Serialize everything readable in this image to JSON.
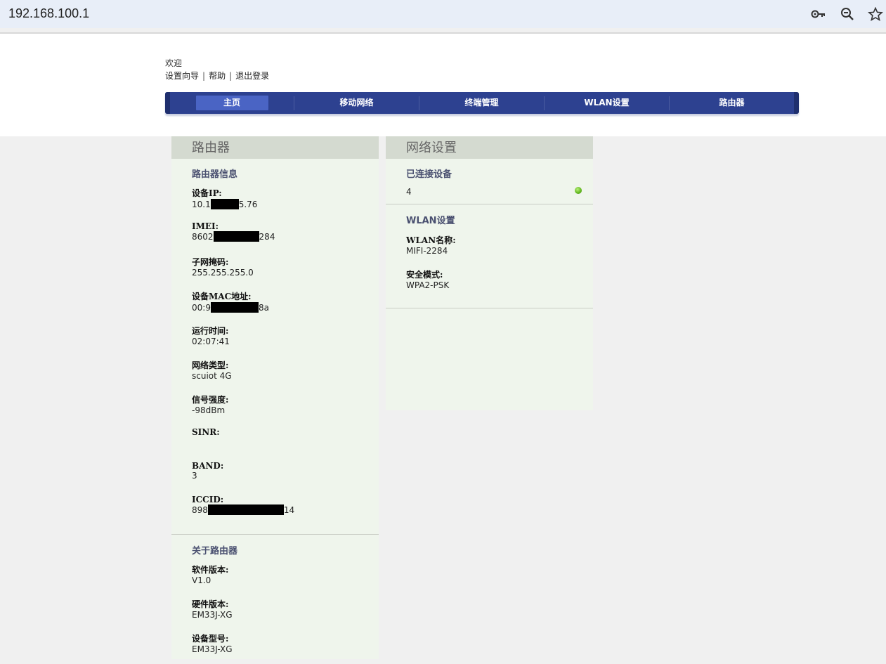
{
  "browser": {
    "url": "192.168.100.1",
    "icons": [
      "key-icon",
      "zoom-icon",
      "star-icon"
    ]
  },
  "header": {
    "welcome": "欢迎",
    "links": [
      "设置向导",
      "帮助",
      "退出登录"
    ]
  },
  "nav": {
    "items": [
      "主页",
      "移动网络",
      "终端管理",
      "WLAN设置",
      "路由器"
    ],
    "active_index": 0
  },
  "router_panel": {
    "title": "路由器",
    "info_title": "路由器信息",
    "fields": [
      {
        "label": "设备IP:",
        "value_pre": "10.1",
        "value_post": "5.76",
        "redacted": true
      },
      {
        "label": "IMEI:",
        "value_pre": "8602",
        "value_post": "284",
        "redacted": true
      },
      {
        "label": "子网掩码:",
        "value_pre": "255.255.255.0",
        "value_post": "",
        "redacted": false
      },
      {
        "label": "设备MAC地址:",
        "value_pre": "00:9",
        "value_post": "8a",
        "redacted": true
      },
      {
        "label": "运行时间:",
        "value_pre": "02:07:41",
        "value_post": "",
        "redacted": false
      },
      {
        "label": "网络类型:",
        "value_pre": "scuiot 4G",
        "value_post": "",
        "redacted": false
      },
      {
        "label": "信号强度:",
        "value_pre": "-98dBm",
        "value_post": "",
        "redacted": false
      },
      {
        "label": "SINR:",
        "value_pre": "",
        "value_post": "",
        "redacted": false
      },
      {
        "label": "BAND:",
        "value_pre": "3",
        "value_post": "",
        "redacted": false
      },
      {
        "label": "ICCID:",
        "value_pre": "898",
        "value_post": "14",
        "redacted": true
      }
    ],
    "about_title": "关于路由器",
    "about_fields": [
      {
        "label": "软件版本:",
        "value": "V1.0"
      },
      {
        "label": "硬件版本:",
        "value": "EM33J-XG"
      },
      {
        "label": "设备型号:",
        "value": "EM33J-XG"
      }
    ]
  },
  "network_panel": {
    "title": "网络设置",
    "connected_title": "已连接设备",
    "connected_count": "4",
    "status_color": "#5fb51c",
    "wlan_title": "WLAN设置",
    "wlan_fields": [
      {
        "label": "WLAN名称:",
        "value": "MIFI-2284"
      },
      {
        "label": "安全模式:",
        "value": "WPA2-PSK"
      }
    ]
  },
  "colors": {
    "nav_bg": "#2d4190",
    "nav_active": "#4a64c4",
    "panel_bg": "#eff5ec",
    "panel_head": "#d4dad0",
    "page_bg": "#f0f0f0"
  }
}
